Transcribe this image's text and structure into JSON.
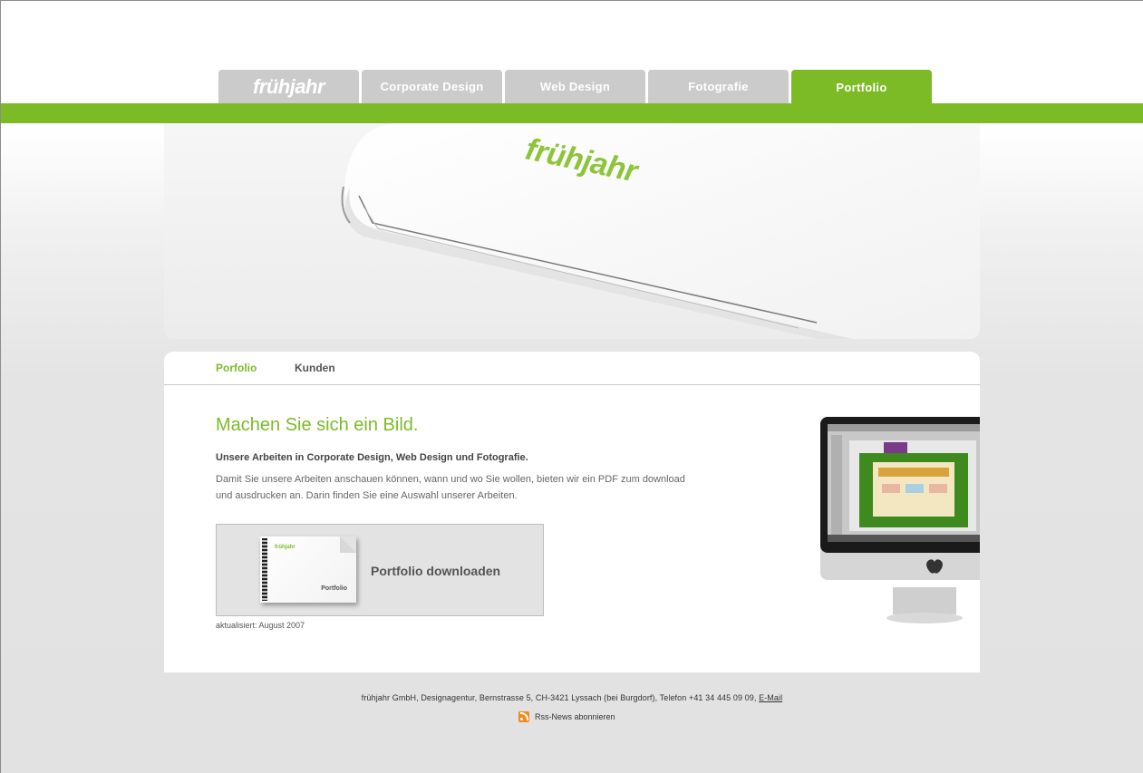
{
  "nav": {
    "logo": "frühjahr",
    "tabs": [
      {
        "label": "Corporate Design"
      },
      {
        "label": "Web Design"
      },
      {
        "label": "Fotografie"
      },
      {
        "label": "Portfolio",
        "active": true
      }
    ]
  },
  "hero": {
    "logo_text": "frühjahr"
  },
  "subnav": {
    "portfolio": "Porfolio",
    "kunden": "Kunden"
  },
  "main": {
    "headline": "Machen Sie sich ein Bild.",
    "lead": "Unsere Arbeiten in Corporate Design, Web Design und Fotografie.",
    "body": "Damit Sie unsere Arbeiten anschauen können, wann und wo Sie wollen, bieten wir ein PDF zum download und ausdrucken an. Darin finden Sie eine Auswahl unserer Arbeiten.",
    "download_label": "Portfolio downloaden",
    "doc_logo": "frühjahr",
    "doc_label": "Portfolio",
    "updated": "aktualisiert: August 2007"
  },
  "footer": {
    "address": "frühjahr GmbH, Designagentur, Bernstrasse 5, CH-3421 Lyssach (bei Burgdorf), Telefon +41 34 445 09 09, ",
    "email_link": "E-Mail",
    "rss": "Rss-News abonnieren"
  },
  "colors": {
    "accent": "#7cbb26",
    "tab_inactive": "#cbcbcb"
  },
  "icons": [
    "rss-icon",
    "apple-icon"
  ]
}
